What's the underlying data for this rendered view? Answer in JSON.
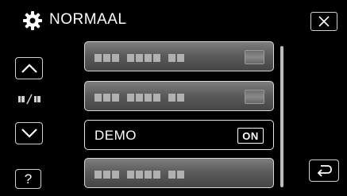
{
  "header": {
    "title": "NORMAAL",
    "icon": "gear-icon",
    "close_icon": "close-icon"
  },
  "nav": {
    "up_icon": "chevron-up-icon",
    "down_icon": "chevron-down-icon",
    "help_label": "?",
    "page_indicator_icon": "page-indicator-icon",
    "back_icon": "return-icon"
  },
  "menu": {
    "items": [
      {
        "label": "",
        "value": "",
        "obscured": true,
        "selected": false
      },
      {
        "label": "",
        "value": "",
        "obscured": true,
        "selected": false
      },
      {
        "label": "DEMO",
        "value": "ON",
        "obscured": false,
        "selected": true
      },
      {
        "label": "",
        "value": "",
        "obscured": true,
        "selected": false
      }
    ]
  },
  "colors": {
    "background": "#000000",
    "button_border": "#cfcfcf",
    "item_gradient_top": "#7e7e7e",
    "item_gradient_bottom": "#454545",
    "text": "#ffffff"
  }
}
